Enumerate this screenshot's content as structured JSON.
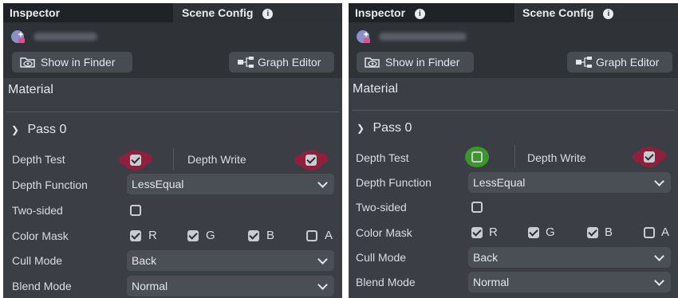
{
  "left": {
    "tabs": {
      "inspector": "Inspector",
      "scene_config": "Scene Config"
    },
    "toolbar": {
      "show_in_finder": "Show in Finder",
      "graph_editor": "Graph Editor"
    },
    "section": "Material",
    "pass": "Pass 0",
    "depth_test_label": "Depth Test",
    "depth_write_label": "Depth Write",
    "depth_function_label": "Depth Function",
    "depth_function_value": "LessEqual",
    "two_sided_label": "Two-sided",
    "color_mask_label": "Color Mask",
    "mask_r": "R",
    "mask_g": "G",
    "mask_b": "B",
    "mask_a": "A",
    "cull_mode_label": "Cull Mode",
    "cull_mode_value": "Back",
    "blend_mode_label": "Blend Mode",
    "blend_mode_value": "Normal",
    "depth_test_checked": true,
    "depth_write_checked": true,
    "two_sided_checked": false
  },
  "right": {
    "tabs": {
      "inspector": "Inspector",
      "scene_config": "Scene Config"
    },
    "toolbar": {
      "show_in_finder": "Show in Finder",
      "graph_editor": "Graph Editor"
    },
    "section": "Material",
    "pass": "Pass 0",
    "depth_test_label": "Depth Test",
    "depth_write_label": "Depth Write",
    "depth_function_label": "Depth Function",
    "depth_function_value": "LessEqual",
    "two_sided_label": "Two-sided",
    "color_mask_label": "Color Mask",
    "mask_r": "R",
    "mask_g": "G",
    "mask_b": "B",
    "mask_a": "A",
    "cull_mode_label": "Cull Mode",
    "cull_mode_value": "Back",
    "blend_mode_label": "Blend Mode",
    "blend_mode_value": "Normal",
    "depth_test_checked": false,
    "depth_write_checked": true,
    "two_sided_checked": false
  },
  "colors": {
    "panel_bg": "#3b3f45",
    "highlight_red": "#961e3c",
    "highlight_green": "#3ca028"
  },
  "icons": {
    "asset": "material-sparkle-icon",
    "finder": "folder-eye-icon",
    "graph": "graph-nodes-icon",
    "info": "info-icon"
  }
}
